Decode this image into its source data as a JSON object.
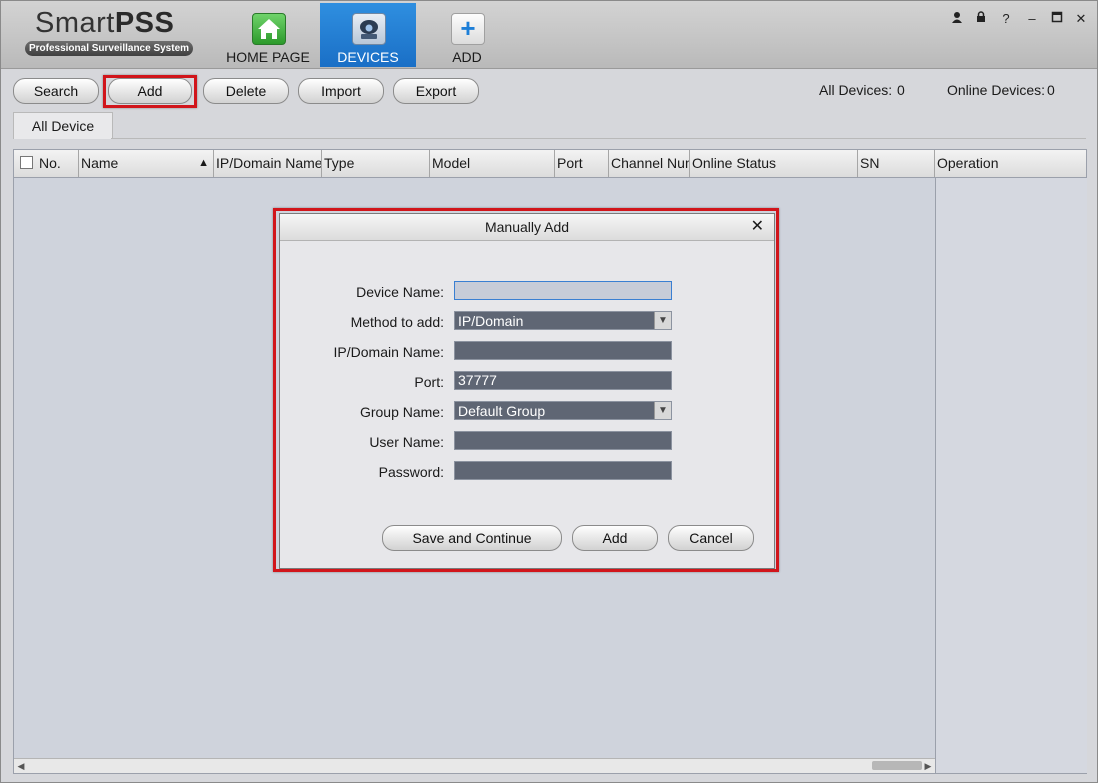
{
  "app": {
    "logo_title_light": "Smart",
    "logo_title_bold": "PSS",
    "logo_subtitle": "Professional Surveillance System"
  },
  "nav": {
    "tabs": [
      {
        "label": "HOME PAGE",
        "icon": "home-icon"
      },
      {
        "label": "DEVICES",
        "icon": "camera-icon",
        "active": true
      },
      {
        "label": "ADD",
        "icon": "plus-icon"
      }
    ]
  },
  "window_controls": {
    "user": "👤",
    "lock": "🔒",
    "help": "?",
    "minimize": "–",
    "maximize": "□",
    "close": "✕"
  },
  "toolbar": {
    "search": "Search",
    "add": "Add",
    "delete": "Delete",
    "import": "Import",
    "export": "Export",
    "all_devices_label": "All Devices:",
    "all_devices_count": "0",
    "online_devices_label": "Online Devices:",
    "online_devices_count": "0"
  },
  "subtab": {
    "label": "All Device"
  },
  "table": {
    "columns": [
      "No.",
      "Name",
      "IP/Domain Name",
      "Type",
      "Model",
      "Port",
      "Channel Num",
      "Online Status",
      "SN",
      "Operation"
    ],
    "rows": []
  },
  "dialog": {
    "title": "Manually Add",
    "close": "✕",
    "fields": {
      "device_name": {
        "label": "Device Name:",
        "value": ""
      },
      "method": {
        "label": "Method to add:",
        "value": "IP/Domain"
      },
      "ip_domain": {
        "label": "IP/Domain Name:",
        "value": ""
      },
      "port": {
        "label": "Port:",
        "value": "37777"
      },
      "group": {
        "label": "Group Name:",
        "value": "Default Group"
      },
      "user": {
        "label": "User Name:",
        "value": ""
      },
      "password": {
        "label": "Password:",
        "value": ""
      }
    },
    "buttons": {
      "save_continue": "Save and Continue",
      "add": "Add",
      "cancel": "Cancel"
    }
  },
  "colors": {
    "highlight": "#d1151b",
    "active_tab": "#1a6fc6"
  }
}
